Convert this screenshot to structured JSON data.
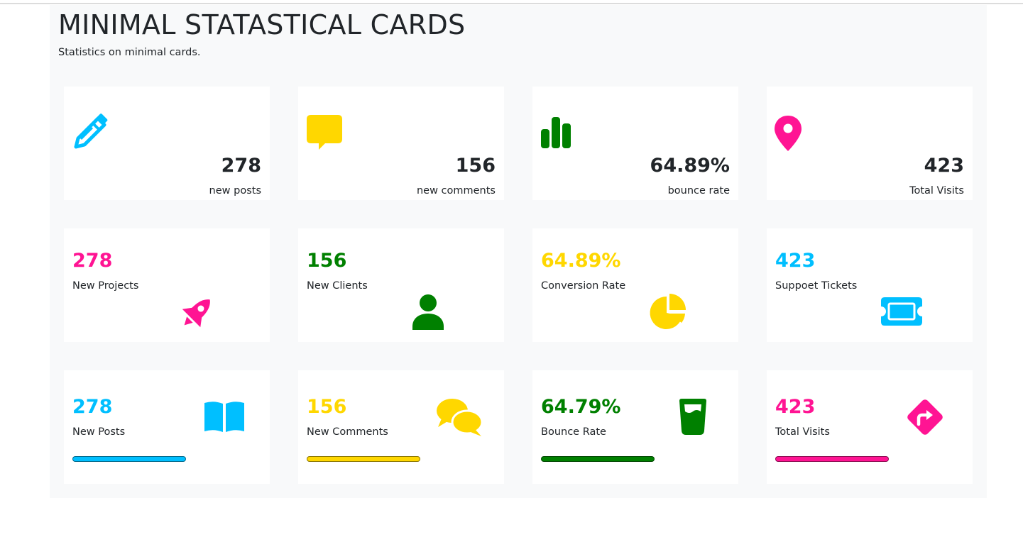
{
  "header": {
    "title": "MINIMAL STATASTICAL CARDS",
    "subtitle": "Statistics on minimal cards."
  },
  "colors": {
    "blue": "#00bfff",
    "yellow": "#ffd700",
    "green": "#008000",
    "pink": "#ff1493"
  },
  "row1": [
    {
      "value": "278",
      "label": "new posts",
      "icon": "pencil-icon",
      "color": "#00bfff"
    },
    {
      "value": "156",
      "label": "new comments",
      "icon": "comment-icon",
      "color": "#ffd700"
    },
    {
      "value": "64.89%",
      "label": "bounce rate",
      "icon": "bar-chart-icon",
      "color": "#008000"
    },
    {
      "value": "423",
      "label": "Total Visits",
      "icon": "map-pin-icon",
      "color": "#ff1493"
    }
  ],
  "row2": [
    {
      "value": "278",
      "label": "New Projects",
      "icon": "rocket-icon",
      "color": "#ff1493"
    },
    {
      "value": "156",
      "label": "New Clients",
      "icon": "user-icon",
      "color": "#008000"
    },
    {
      "value": "64.89%",
      "label": "Conversion Rate",
      "icon": "pie-chart-icon",
      "color": "#ffd700"
    },
    {
      "value": "423",
      "label": "Suppoet Tickets",
      "icon": "ticket-icon",
      "color": "#00bfff"
    }
  ],
  "row3": [
    {
      "value": "278",
      "label": "New Posts",
      "icon": "book-icon",
      "color": "#00bfff",
      "progress_percent": 100
    },
    {
      "value": "156",
      "label": "New Comments",
      "icon": "comments-icon",
      "color": "#ffd700",
      "progress_percent": 100
    },
    {
      "value": "64.79%",
      "label": "Bounce Rate",
      "icon": "glass-icon",
      "color": "#008000",
      "progress_percent": 100
    },
    {
      "value": "423",
      "label": "Total Visits",
      "icon": "directions-icon",
      "color": "#ff1493",
      "progress_percent": 100
    }
  ]
}
